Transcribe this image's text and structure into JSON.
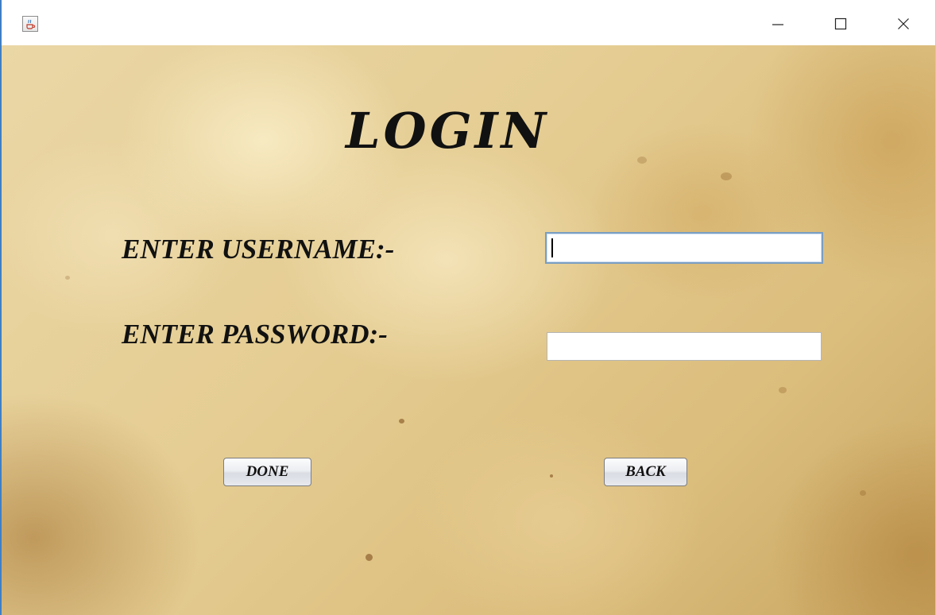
{
  "window": {
    "icon": "java-cup-icon",
    "controls": {
      "minimize": "minimize-icon",
      "maximize": "maximize-icon",
      "close": "close-icon"
    }
  },
  "form": {
    "title": "LOGIN",
    "username_label": "ENTER USERNAME:-",
    "username_value": "",
    "password_label": "ENTER PASSWORD:-",
    "password_value": ""
  },
  "buttons": {
    "done_label": "DONE",
    "back_label": "BACK"
  },
  "colors": {
    "window_border": "#3f7fc4",
    "text": "#111111",
    "parchment": "#e3cc95",
    "focused_field_border": "#7a9ec2"
  }
}
